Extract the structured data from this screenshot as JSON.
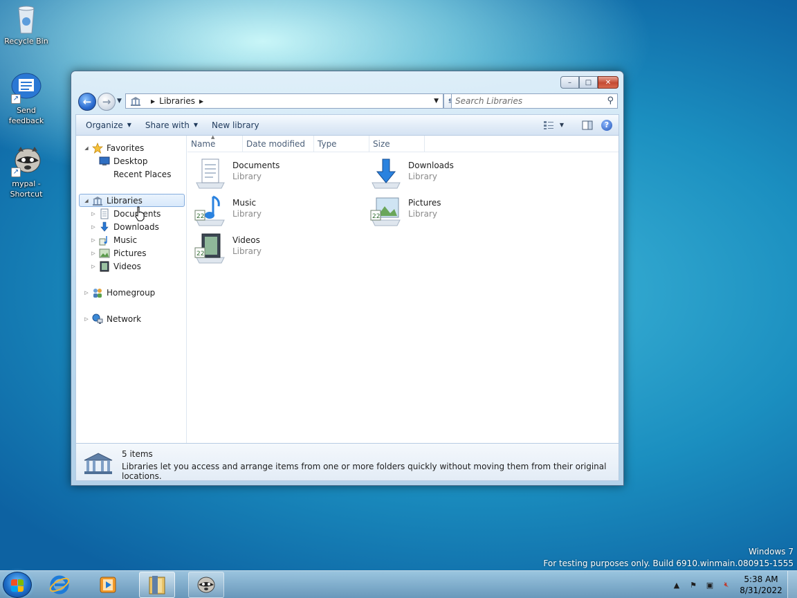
{
  "desktop": {
    "icons": [
      {
        "label": "Recycle Bin",
        "icon": "recycle-bin-icon"
      },
      {
        "label": "Send feedback",
        "icon": "feedback-icon"
      },
      {
        "label": "mypal - Shortcut",
        "icon": "raccoon-icon"
      }
    ],
    "watermark_line1": "Windows 7",
    "watermark_line2": "For testing purposes only. Build 6910.winmain.080915-1555"
  },
  "window": {
    "caption_buttons": {
      "minimize": "–",
      "maximize": "□",
      "close": "✕"
    },
    "address": {
      "crumb": "Libraries"
    },
    "search": {
      "placeholder": "Search Libraries"
    },
    "toolbar": {
      "organize": "Organize",
      "share_with": "Share with",
      "new_library": "New library"
    },
    "nav": {
      "favorites": "Favorites",
      "favorites_items": [
        "Desktop",
        "Recent Places"
      ],
      "libraries": "Libraries",
      "library_items": [
        "Documents",
        "Downloads",
        "Music",
        "Pictures",
        "Videos"
      ],
      "homegroup": "Homegroup",
      "network": "Network"
    },
    "columns": [
      "Name",
      "Date modified",
      "Type",
      "Size"
    ],
    "items": [
      {
        "name": "Documents",
        "type": "Library",
        "icon": "documents-library-icon"
      },
      {
        "name": "Downloads",
        "type": "Library",
        "icon": "downloads-library-icon"
      },
      {
        "name": "Music",
        "type": "Library",
        "icon": "music-library-icon"
      },
      {
        "name": "Pictures",
        "type": "Library",
        "icon": "pictures-library-icon"
      },
      {
        "name": "Videos",
        "type": "Library",
        "icon": "videos-library-icon"
      }
    ],
    "details": {
      "count": "5 items",
      "description": "Libraries let you access and arrange items from one or more folders quickly without moving them from their original locations."
    }
  },
  "taskbar": {
    "time": "5:38 AM",
    "date": "8/31/2022",
    "pinned": [
      "internet-explorer-icon",
      "media-player-icon",
      "explorer-icon",
      "mypal-icon"
    ]
  },
  "colors": {
    "accent": "#1d6cc7",
    "selection": "#d9e9fb"
  }
}
